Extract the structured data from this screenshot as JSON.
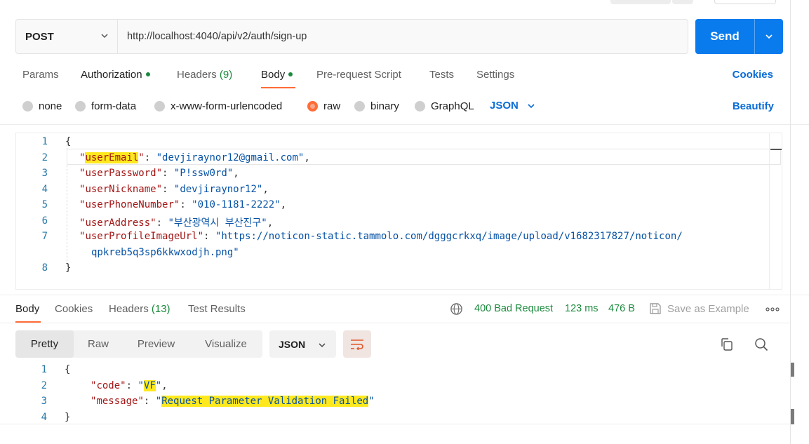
{
  "request": {
    "method": "POST",
    "url": "http://localhost:4040/api/v2/auth/sign-up",
    "send_label": "Send"
  },
  "request_tabs": {
    "params": "Params",
    "authorization": "Authorization",
    "headers": "Headers",
    "headers_count": "(9)",
    "body": "Body",
    "prerequest": "Pre-request Script",
    "tests": "Tests",
    "settings": "Settings",
    "cookies": "Cookies"
  },
  "body_types": {
    "none": "none",
    "form_data": "form-data",
    "urlencoded": "x-www-form-urlencoded",
    "raw": "raw",
    "binary": "binary",
    "graphql": "GraphQL",
    "format": "JSON",
    "beautify": "Beautify"
  },
  "request_body": {
    "line_numbers": [
      "1",
      "2",
      "3",
      "4",
      "5",
      "6",
      "7",
      "8"
    ],
    "open_brace": "{",
    "close_brace": "}",
    "fields": [
      {
        "key": "userEmail",
        "value": "devjiraynor12@gmail.com"
      },
      {
        "key": "userPassword",
        "value": "P!ssw0rd"
      },
      {
        "key": "userNickname",
        "value": "devjiraynor12"
      },
      {
        "key": "userPhoneNumber",
        "value": "010-1181-2222"
      },
      {
        "key": "userAddress",
        "value": "부산광역시 부산진구"
      },
      {
        "key": "userProfileImageUrl",
        "value": "https://noticon-static.tammolo.com/dgggcrkxq/image/upload/v1682317827/noticon/",
        "value_cont": "qpkreb5q3sp6kkwxodjh.png"
      }
    ]
  },
  "response_tabs": {
    "body": "Body",
    "cookies": "Cookies",
    "headers": "Headers",
    "headers_count": "(13)",
    "test_results": "Test Results",
    "status": "400 Bad Request",
    "time": "123 ms",
    "size": "476 B",
    "save_example": "Save as Example"
  },
  "response_view": {
    "pretty": "Pretty",
    "raw": "Raw",
    "preview": "Preview",
    "visualize": "Visualize",
    "format": "JSON"
  },
  "response_body": {
    "line_numbers": [
      "1",
      "2",
      "3",
      "4"
    ],
    "open_brace": "{",
    "close_brace": "}",
    "code_key": "code",
    "code_value": "VF",
    "message_key": "message",
    "message_value": "Request Parameter Validation Failed"
  },
  "colors": {
    "accent": "#ff6c37",
    "send": "#097bed",
    "link": "#0a6cd6",
    "status": "#1b8a3d",
    "highlight": "#ffe91e"
  }
}
